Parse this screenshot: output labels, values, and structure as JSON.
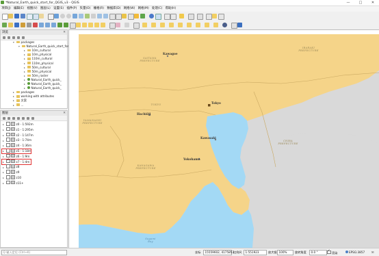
{
  "window": {
    "title": "*Natural_Earth_quick_start_for_QGIS_v3 - QGIS",
    "minimize": "—",
    "maximize": "□",
    "close": "✕"
  },
  "menu": [
    "项目(J)",
    "编辑(E)",
    "视图(V)",
    "图层(L)",
    "设置(S)",
    "插件(P)",
    "矢量(O)",
    "栅格(R)",
    "数据库(D)",
    "网络(W)",
    "网格(M)",
    "处理(C)",
    "帮助(H)"
  ],
  "browser_panel": {
    "title": "浏览",
    "close": "✕",
    "items": [
      {
        "label": "packages",
        "kind": "folder",
        "expanded": true
      },
      {
        "label": "Natural_Earth_quick_start_for",
        "kind": "folder",
        "expanded": true
      },
      {
        "label": "10m_cultural",
        "kind": "folder"
      },
      {
        "label": "10m_physical",
        "kind": "folder"
      },
      {
        "label": "110m_cultural",
        "kind": "folder"
      },
      {
        "label": "110m_physical",
        "kind": "folder"
      },
      {
        "label": "50m_cultural",
        "kind": "folder"
      },
      {
        "label": "50m_physical",
        "kind": "folder"
      },
      {
        "label": "50m_raster",
        "kind": "folder"
      },
      {
        "label": "Natural_Earth_quick_",
        "kind": "qgs"
      },
      {
        "label": "Natural_Earth_quick_",
        "kind": "qgs"
      },
      {
        "label": "Natural_Earth_quick_",
        "kind": "qgs"
      },
      {
        "label": "packages",
        "kind": "folder"
      },
      {
        "label": "working with attributes",
        "kind": "folder"
      },
      {
        "label": "文案",
        "kind": "folder"
      },
      {
        "label": "...",
        "kind": "folder"
      }
    ]
  },
  "layers_panel": {
    "title": "图层",
    "close": "✕",
    "items": [
      {
        "label": "z0 - 1:592m",
        "checked": false,
        "highlight": false
      },
      {
        "label": "z1 - 1:295m",
        "checked": false,
        "highlight": false
      },
      {
        "label": "z2 - 1:147m",
        "checked": false,
        "highlight": false
      },
      {
        "label": "z3 - 1:74m",
        "checked": false,
        "highlight": false
      },
      {
        "label": "z4 - 1:36m",
        "checked": false,
        "highlight": false
      },
      {
        "label": "z5 - 1:18m",
        "checked": false,
        "highlight": true
      },
      {
        "label": "z6 - 1:9m",
        "checked": false,
        "highlight": false
      },
      {
        "label": "z7 - 1:4m",
        "checked": true,
        "highlight": true
      },
      {
        "label": "z8",
        "checked": false,
        "highlight": false
      },
      {
        "label": "z9",
        "checked": false,
        "highlight": false
      },
      {
        "label": "z10",
        "checked": false,
        "highlight": false
      },
      {
        "label": "z11+",
        "checked": false,
        "highlight": false
      }
    ]
  },
  "map": {
    "colors": {
      "land": "#f5d489",
      "sea": "#a3d9f5",
      "outside": "#d9d9d9",
      "frame": "#ffffff"
    },
    "prefectures": [
      {
        "text": "SAITAMA\nPREFECTURE"
      },
      {
        "text": "IBARAKI\nPREFECTURE"
      },
      {
        "text": "YAMANASHI\nPREFECTURE"
      },
      {
        "text": "KANAGAWA\nPREFECTURE"
      },
      {
        "text": "CHIBA\nPREFECTURE"
      },
      {
        "text": "TOKYO"
      }
    ],
    "cities": [
      "Kawagoe",
      "Tokyo",
      "Hachiōji",
      "Kawasaki",
      "Yokohama"
    ],
    "sea_label": "Sagami\nBay"
  },
  "statusbar": {
    "search_placeholder": "Q 输入定位 (Ctrl+K)",
    "coord_label": "坐标",
    "coord_value": "15559602, 4175853",
    "scale_label": "比例尺",
    "scale_value": "1:551923",
    "magnifier_label": "放大镜",
    "magnifier_value": "100%",
    "rotation_label": "旋转角度",
    "rotation_value": "0.0 °",
    "render_label": "渲染",
    "crs": "EPSG:3857"
  }
}
